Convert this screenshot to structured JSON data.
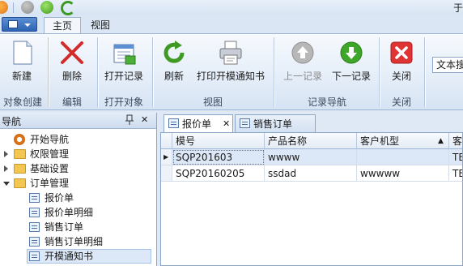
{
  "ribbon_tabs": [
    "主页",
    "视图"
  ],
  "title_fragment": "于",
  "ribbon_groups": [
    {
      "label": "对象创建",
      "buttons": [
        "新建"
      ]
    },
    {
      "label": "编辑",
      "buttons": [
        "删除"
      ]
    },
    {
      "label": "打开对象",
      "buttons": [
        "打开记录"
      ]
    },
    {
      "label": "视图",
      "buttons": [
        "刷新",
        "打印开模通知书"
      ]
    },
    {
      "label": "记录导航",
      "buttons": [
        "上一记录",
        "下一记录"
      ]
    },
    {
      "label": "关闭",
      "buttons": [
        "关闭"
      ]
    }
  ],
  "search_box": "文本搜",
  "nav": {
    "title": "导航",
    "pin": "ᵖ",
    "close": "✕",
    "items": [
      {
        "label": "开始导航",
        "level": 0,
        "kind": "home"
      },
      {
        "label": "权限管理",
        "level": 0,
        "kind": "folder",
        "expanded": false
      },
      {
        "label": "基础设置",
        "level": 0,
        "kind": "folder",
        "expanded": false
      },
      {
        "label": "订单管理",
        "level": 0,
        "kind": "folder",
        "expanded": true
      },
      {
        "label": "报价单",
        "level": 1,
        "kind": "doc"
      },
      {
        "label": "报价单明细",
        "level": 1,
        "kind": "doc"
      },
      {
        "label": "销售订单",
        "level": 1,
        "kind": "doc"
      },
      {
        "label": "销售订单明细",
        "level": 1,
        "kind": "doc"
      },
      {
        "label": "开模通知书",
        "level": 1,
        "kind": "doc",
        "selected": true
      }
    ]
  },
  "doc_tabs": [
    {
      "label": "报价单",
      "active": true,
      "close": "✕"
    },
    {
      "label": "销售订单",
      "active": false
    }
  ],
  "grid": {
    "columns": [
      "模号",
      "产品名称",
      "客户机型",
      "客"
    ],
    "sort_indicator": "▲",
    "row_indicator": "▶",
    "rows": [
      [
        "SQP201603",
        "wwww",
        "",
        "TE"
      ],
      [
        "SQP20160205",
        "ssdad",
        "wwwww",
        "TE"
      ]
    ]
  },
  "colors": {
    "accent": "#2d63b3",
    "selection": "#dce8f7",
    "grid_line": "#d4dde9"
  }
}
